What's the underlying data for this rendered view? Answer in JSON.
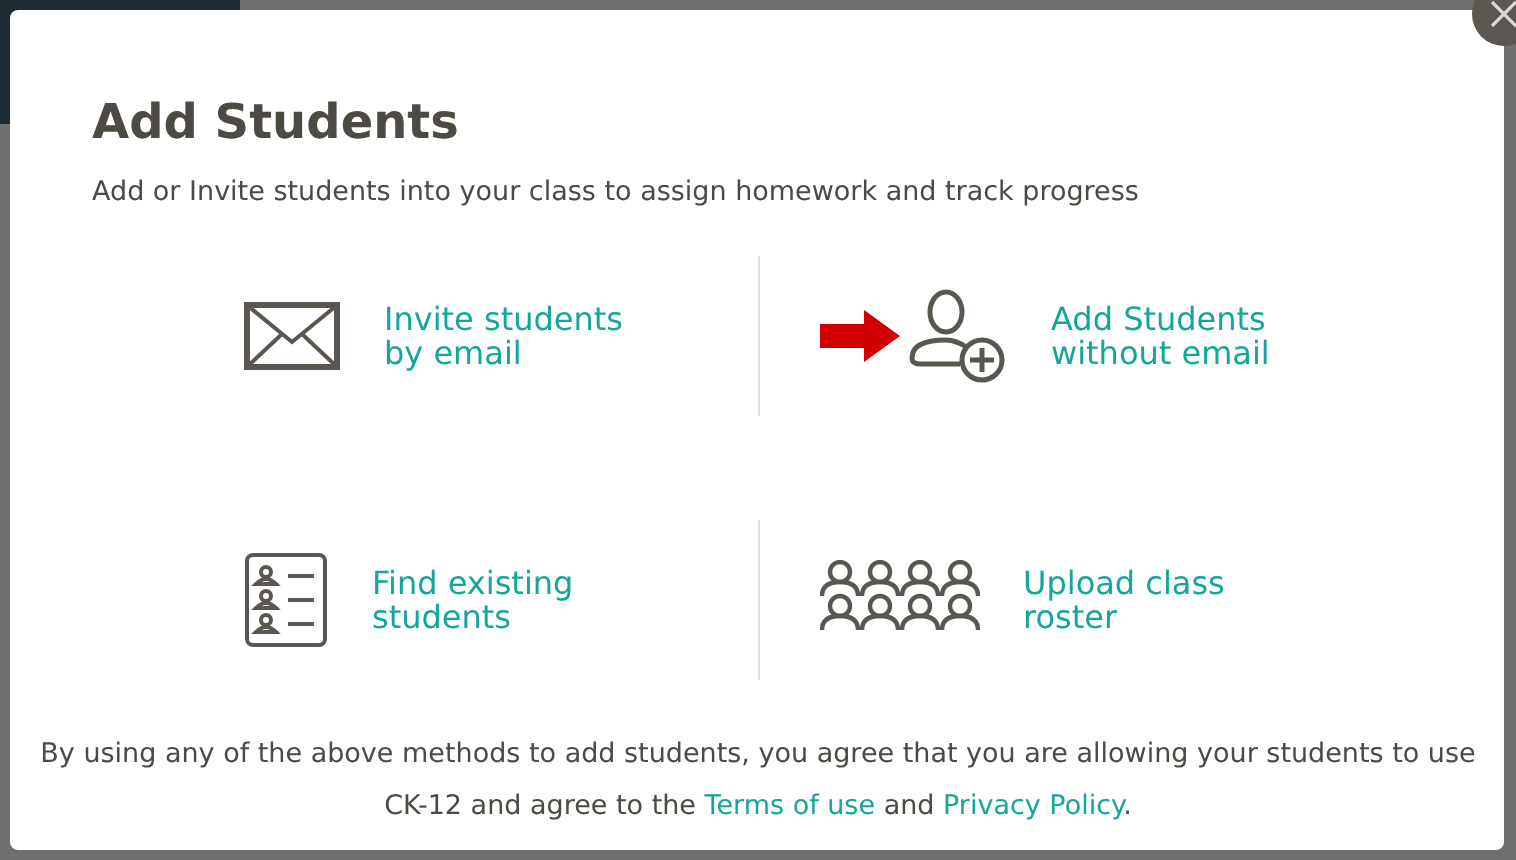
{
  "dialog": {
    "title": "Add Students",
    "subtitle": "Add or Invite students into your class to assign homework and track progress",
    "options": [
      {
        "kind": "email",
        "label": [
          "Invite students",
          "by email"
        ],
        "pointed": false
      },
      {
        "kind": "add-person",
        "label": [
          "Add Students",
          "without email"
        ],
        "pointed": true
      },
      {
        "kind": "list",
        "label": [
          "Find existing",
          "students"
        ],
        "pointed": false
      },
      {
        "kind": "group",
        "label": [
          "Upload class",
          "roster"
        ],
        "pointed": false
      }
    ],
    "footer": [
      {
        "kind": "text",
        "text": "By using any of the above methods to add students, you agree that you are allowing your students to use CK-12 and agree to the "
      },
      {
        "kind": "link",
        "text": "Terms of use"
      },
      {
        "kind": "text",
        "text": " and "
      },
      {
        "kind": "link",
        "text": "Privacy Policy"
      },
      {
        "kind": "text",
        "text": "."
      }
    ]
  }
}
